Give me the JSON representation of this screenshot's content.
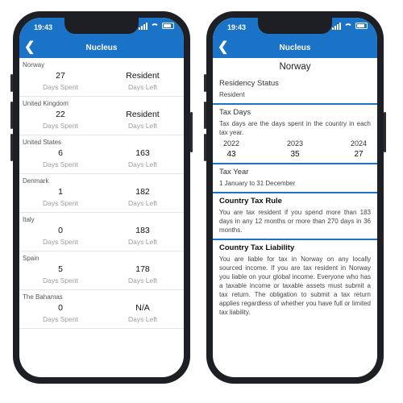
{
  "status": {
    "time": "19:43"
  },
  "app": {
    "title": "Nucleus",
    "back": "❮"
  },
  "left": {
    "rows": [
      {
        "country": "Norway",
        "spent": "27",
        "right_value": "Resident"
      },
      {
        "country": "United Kingdom",
        "spent": "22",
        "right_value": "Resident"
      },
      {
        "country": "United States",
        "spent": "6",
        "right_value": "163"
      },
      {
        "country": "Denmark",
        "spent": "1",
        "right_value": "182"
      },
      {
        "country": "Italy",
        "spent": "0",
        "right_value": "183"
      },
      {
        "country": "Spain",
        "spent": "5",
        "right_value": "178"
      },
      {
        "country": "The Bahamas",
        "spent": "0",
        "right_value": "N/A"
      }
    ],
    "days_spent_label": "Days Spent",
    "days_left_label": "Days Left"
  },
  "right": {
    "country": "Norway",
    "residency": {
      "title": "Residency Status",
      "value": "Resident"
    },
    "tax_days": {
      "title": "Tax Days",
      "desc": "Tax days are the days spent in the country in each tax year.",
      "years": [
        "2022",
        "2023",
        "2024"
      ],
      "values": [
        "43",
        "35",
        "27"
      ]
    },
    "tax_year": {
      "title": "Tax Year",
      "value": "1 January to 31 December"
    },
    "rule": {
      "title": "Country Tax Rule",
      "text": "You are tax resident if you spend more than 183 days in any 12 months or more than 270 days in 36 months."
    },
    "liability": {
      "title": "Country Tax Liability",
      "text": "You are liable for tax in Norway on any locally sourced income.     If you are tax resident in Norway you liable on your global income. Everyone who has a taxable income or taxable assets must submit a tax return. The obligation to submit a tax return applies regardless of whether you have full or limited tax liability."
    }
  },
  "colors": {
    "accent": "#1b73c8",
    "phone": "#1d1f24"
  }
}
